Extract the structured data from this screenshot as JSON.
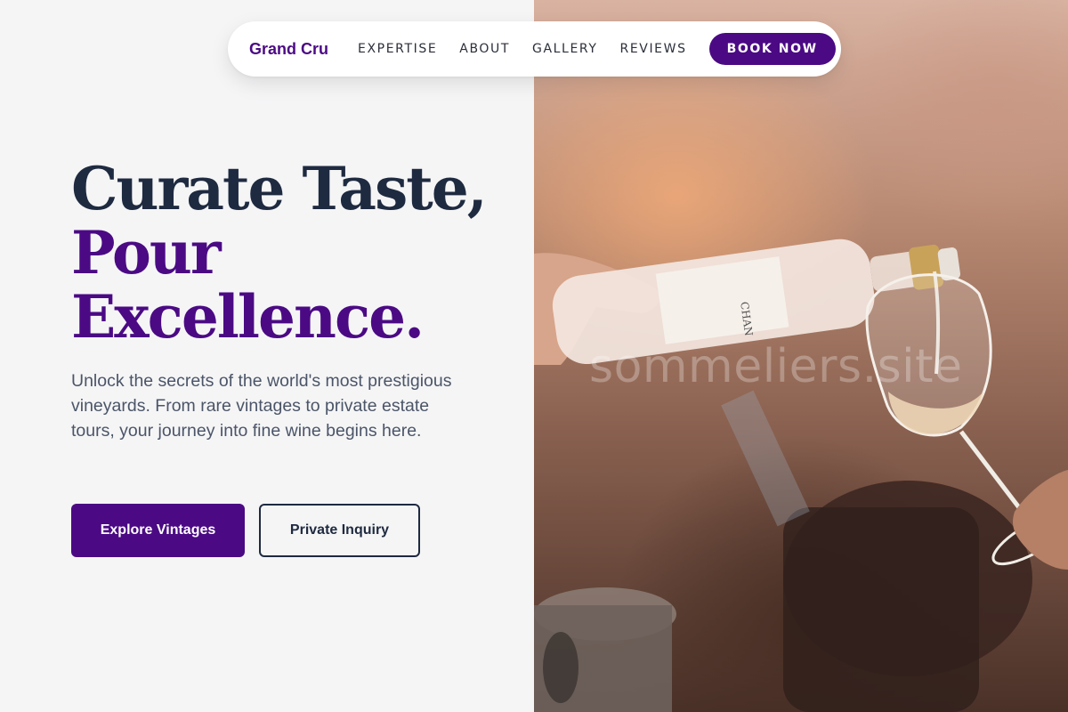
{
  "nav": {
    "brand": "Grand Cru",
    "links": [
      "EXPERTISE",
      "ABOUT",
      "GALLERY",
      "REVIEWS"
    ],
    "cta": "BOOK NOW"
  },
  "hero": {
    "headline_line1": "Curate Taste,",
    "headline_line2": "Pour",
    "headline_line3": "Excellence.",
    "subtitle": "Unlock the secrets of the world's most prestigious vineyards. From rare vintages to private estate tours, your journey into fine wine begins here.",
    "primary_button": "Explore Vintages",
    "secondary_button": "Private Inquiry",
    "image_alt": "wine-pouring-photo",
    "watermark": "sommeliers.site"
  },
  "colors": {
    "brand_purple": "#4b0a84",
    "navy": "#1e2a40",
    "body_text": "#4b5568",
    "background": "#f5f5f6"
  }
}
